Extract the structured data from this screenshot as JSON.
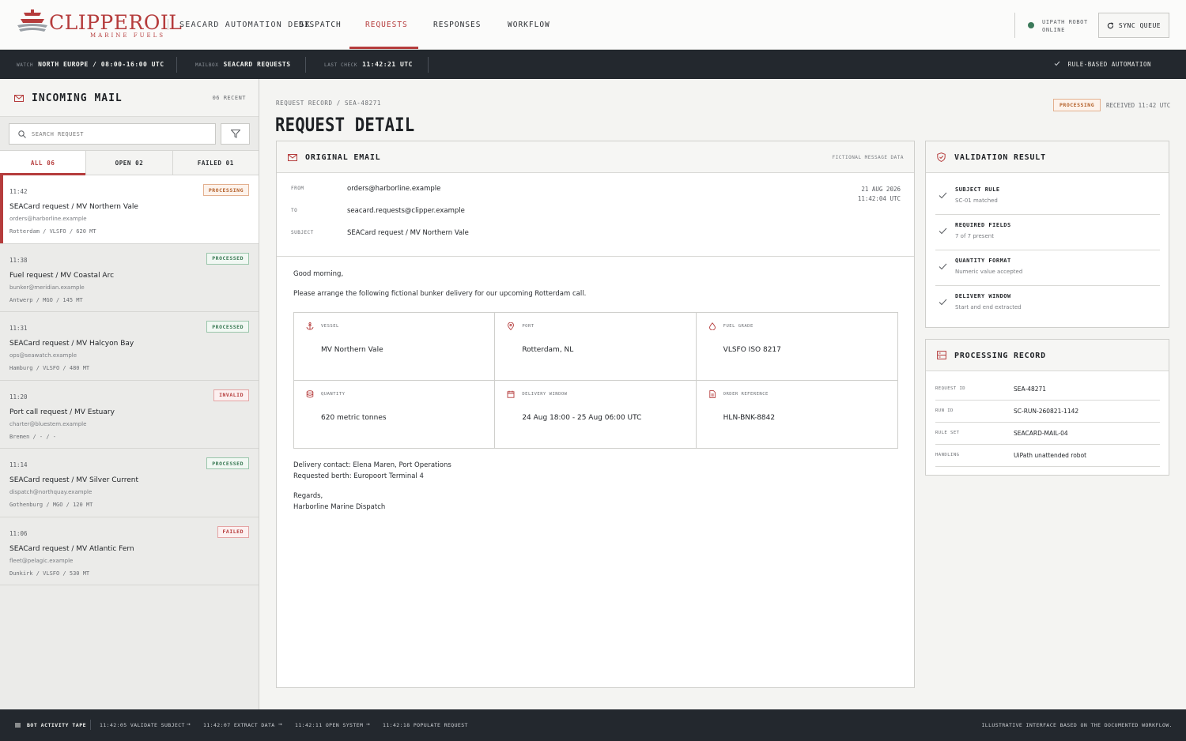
{
  "brand": {
    "name": "CLIPPEROIL",
    "tagline": "MARINE FUELS",
    "desk": "SEACARD AUTOMATION DESK"
  },
  "nav": {
    "tabs": [
      {
        "label": "DISPATCH"
      },
      {
        "label": "REQUESTS",
        "active": true
      },
      {
        "label": "RESPONSES"
      },
      {
        "label": "WORKFLOW"
      }
    ]
  },
  "robot": {
    "line1": "UIPATH ROBOT",
    "line2": "ONLINE",
    "status_color": "#3c7a5a"
  },
  "sync": {
    "label": "SYNC QUEUE"
  },
  "status_strip": {
    "watch_key": "WATCH",
    "watch_val": "NORTH EUROPE / 08:00-16:00 UTC",
    "mailbox_key": "MAILBOX",
    "mailbox_val": "SEACARD REQUESTS",
    "check_key": "LAST CHECK",
    "check_val": "11:42:21 UTC",
    "automation": "RULE-BASED AUTOMATION"
  },
  "inbox": {
    "title": "INCOMING MAIL",
    "count": "06 RECENT",
    "search_placeholder": "SEARCH REQUEST",
    "tabs": [
      {
        "label": "ALL 06",
        "active": true
      },
      {
        "label": "OPEN 02"
      },
      {
        "label": "FAILED 01"
      }
    ],
    "items": [
      {
        "time": "11:42",
        "badge": "PROCESSING",
        "status": "processing",
        "subject": "SEACard request / MV Northern Vale",
        "from": "orders@harborline.example",
        "meta": "Rotterdam / VLSFO / 620 MT",
        "selected": true
      },
      {
        "time": "11:38",
        "badge": "PROCESSED",
        "status": "processed",
        "subject": "Fuel request / MV Coastal Arc",
        "from": "bunker@meridian.example",
        "meta": "Antwerp / MGO / 145 MT"
      },
      {
        "time": "11:31",
        "badge": "PROCESSED",
        "status": "processed",
        "subject": "SEACard request / MV Halcyon Bay",
        "from": "ops@seawatch.example",
        "meta": "Hamburg / VLSFO / 480 MT"
      },
      {
        "time": "11:20",
        "badge": "INVALID",
        "status": "invalid",
        "subject": "Port call request / MV Estuary",
        "from": "charter@bluestem.example",
        "meta": "Bremen / - / -"
      },
      {
        "time": "11:14",
        "badge": "PROCESSED",
        "status": "processed",
        "subject": "SEACard request / MV Silver Current",
        "from": "dispatch@northquay.example",
        "meta": "Gothenburg / MGO / 120 MT"
      },
      {
        "time": "11:06",
        "badge": "FAILED",
        "status": "failed",
        "subject": "SEACard request / MV Atlantic Fern",
        "from": "fleet@pelagic.example",
        "meta": "Dunkirk / VLSFO / 530 MT"
      }
    ]
  },
  "record": {
    "crumb": "REQUEST RECORD / SEA-48271",
    "title": "REQUEST DETAIL",
    "badge": "PROCESSING",
    "received": "RECEIVED 11:42 UTC"
  },
  "email": {
    "title": "ORIGINAL EMAIL",
    "note": "FICTIONAL MESSAGE DATA",
    "from_key": "FROM",
    "from": "orders@harborline.example",
    "to_key": "TO",
    "to": "seacard.requests@clipper.example",
    "subject_key": "SUBJECT",
    "subject": "SEACard request / MV Northern Vale",
    "date": "21 AUG 2026",
    "time": "11:42:04 UTC",
    "greeting": "Good morning,",
    "intro": "Please arrange the following fictional bunker delivery for our upcoming Rotterdam call.",
    "fields": [
      {
        "key": "VESSEL",
        "value": "MV Northern Vale",
        "icon": "anchor-icon"
      },
      {
        "key": "PORT",
        "value": "Rotterdam, NL",
        "icon": "location-pin-icon"
      },
      {
        "key": "FUEL GRADE",
        "value": "VLSFO ISO 8217",
        "icon": "fuel-drop-icon"
      },
      {
        "key": "QUANTITY",
        "value": "620 metric tonnes",
        "icon": "database-icon"
      },
      {
        "key": "DELIVERY WINDOW",
        "value": "24 Aug 18:00 - 25 Aug 06:00 UTC",
        "icon": "calendar-icon"
      },
      {
        "key": "ORDER REFERENCE",
        "value": "HLN-BNK-8842",
        "icon": "document-icon"
      }
    ],
    "contact": "Delivery contact: Elena Maren, Port Operations",
    "berth": "Requested berth: Europoort Terminal 4",
    "regards": "Regards,",
    "signoff": "Harborline Marine Dispatch"
  },
  "validation": {
    "title": "VALIDATION RESULT",
    "rows": [
      {
        "title": "SUBJECT RULE",
        "desc": "SC-01 matched"
      },
      {
        "title": "REQUIRED FIELDS",
        "desc": "7 of 7 present"
      },
      {
        "title": "QUANTITY FORMAT",
        "desc": "Numeric value accepted"
      },
      {
        "title": "DELIVERY WINDOW",
        "desc": "Start and end extracted"
      }
    ]
  },
  "processing": {
    "title": "PROCESSING RECORD",
    "rows": [
      {
        "key": "REQUEST ID",
        "value": "SEA-48271"
      },
      {
        "key": "RUN ID",
        "value": "SC-RUN-260821-1142"
      },
      {
        "key": "RULE SET",
        "value": "SEACARD-MAIL-04"
      },
      {
        "key": "HANDLING",
        "value": "UiPath unattended robot"
      }
    ]
  },
  "tape": {
    "title": "BOT ACTIVITY TAPE",
    "steps": [
      "11:42:05 VALIDATE SUBJECT",
      "11:42:07 EXTRACT DATA",
      "11:42:11 OPEN SYSTEM",
      "11:42:18 POPULATE REQUEST"
    ],
    "note": "ILLUSTRATIVE INTERFACE BASED ON THE DOCUMENTED WORKFLOW."
  },
  "colors": {
    "accent": "#b53c3c",
    "dark": "#23282e",
    "success": "#3b7a55",
    "warning": "#b4602a"
  }
}
